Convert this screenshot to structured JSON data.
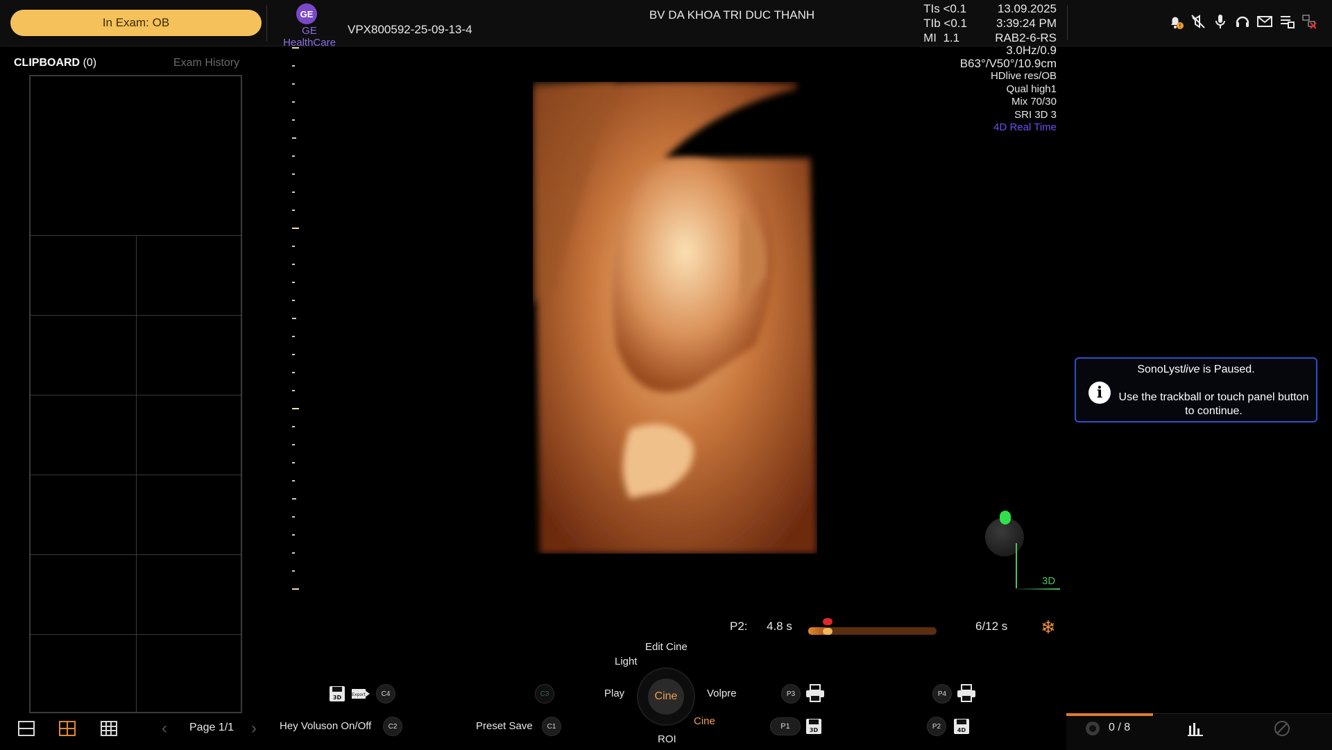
{
  "header": {
    "exam_status": "In Exam: OB",
    "brand_logo": "GE",
    "brand": "GE HealthCare",
    "patient_id": "VPX800592-25-09-13-4",
    "hospital": "BV DA KHOA TRI DUC THANH",
    "tis": "TIs <0.1",
    "tib": "TIb <0.1",
    "mi": "MI  1.1",
    "date": "13.09.2025",
    "time": "3:39:24 PM",
    "probe": "RAB2-6-RS",
    "icons": [
      "bell-warning-icon",
      "mute-icon",
      "microphone-icon",
      "headset-icon",
      "mail-icon",
      "report-icon",
      "network-off-icon"
    ]
  },
  "clipboard": {
    "title": "CLIPBOARD",
    "count": "(0)",
    "exam_history": "Exam History"
  },
  "image_params": {
    "freq": "3.0Hz/0.9",
    "angles": "B63°/V50°/10.9cm",
    "mode": "HDlive res/OB",
    "quality": "Qual high1",
    "mix": "Mix 70/30",
    "sri": "SRI 3D 3",
    "realtime": "4D Real Time",
    "realtime_color": "#6a4ff0",
    "orientation": "3D"
  },
  "notice": {
    "title_pre": "SonoLyst",
    "title_em": "live",
    "title_post": " is Paused.",
    "body": "Use the trackball or touch panel button to continue."
  },
  "cine": {
    "label": "P2:",
    "duration": "4.8 s",
    "frames": "6/12 s",
    "progress": 0.15
  },
  "controls": {
    "edit_cine": "Edit Cine",
    "light": "Light",
    "play": "Play",
    "cine_center": "Cine",
    "volpre": "Volpre",
    "cine_lower": "Cine",
    "roi": "ROI",
    "hey_voluson": "Hey Voluson On/Off",
    "preset_save": "Preset Save",
    "c1": "C1",
    "c2": "C2",
    "c3": "C3",
    "c4": "C4",
    "p1": "P1",
    "p2": "P2",
    "p3": "P3",
    "p4": "P4",
    "save_3d_label": "3D",
    "export_label": "Export",
    "save_4d_label": "4D"
  },
  "footer": {
    "page": "Page 1/1",
    "counter": "0 / 8"
  }
}
